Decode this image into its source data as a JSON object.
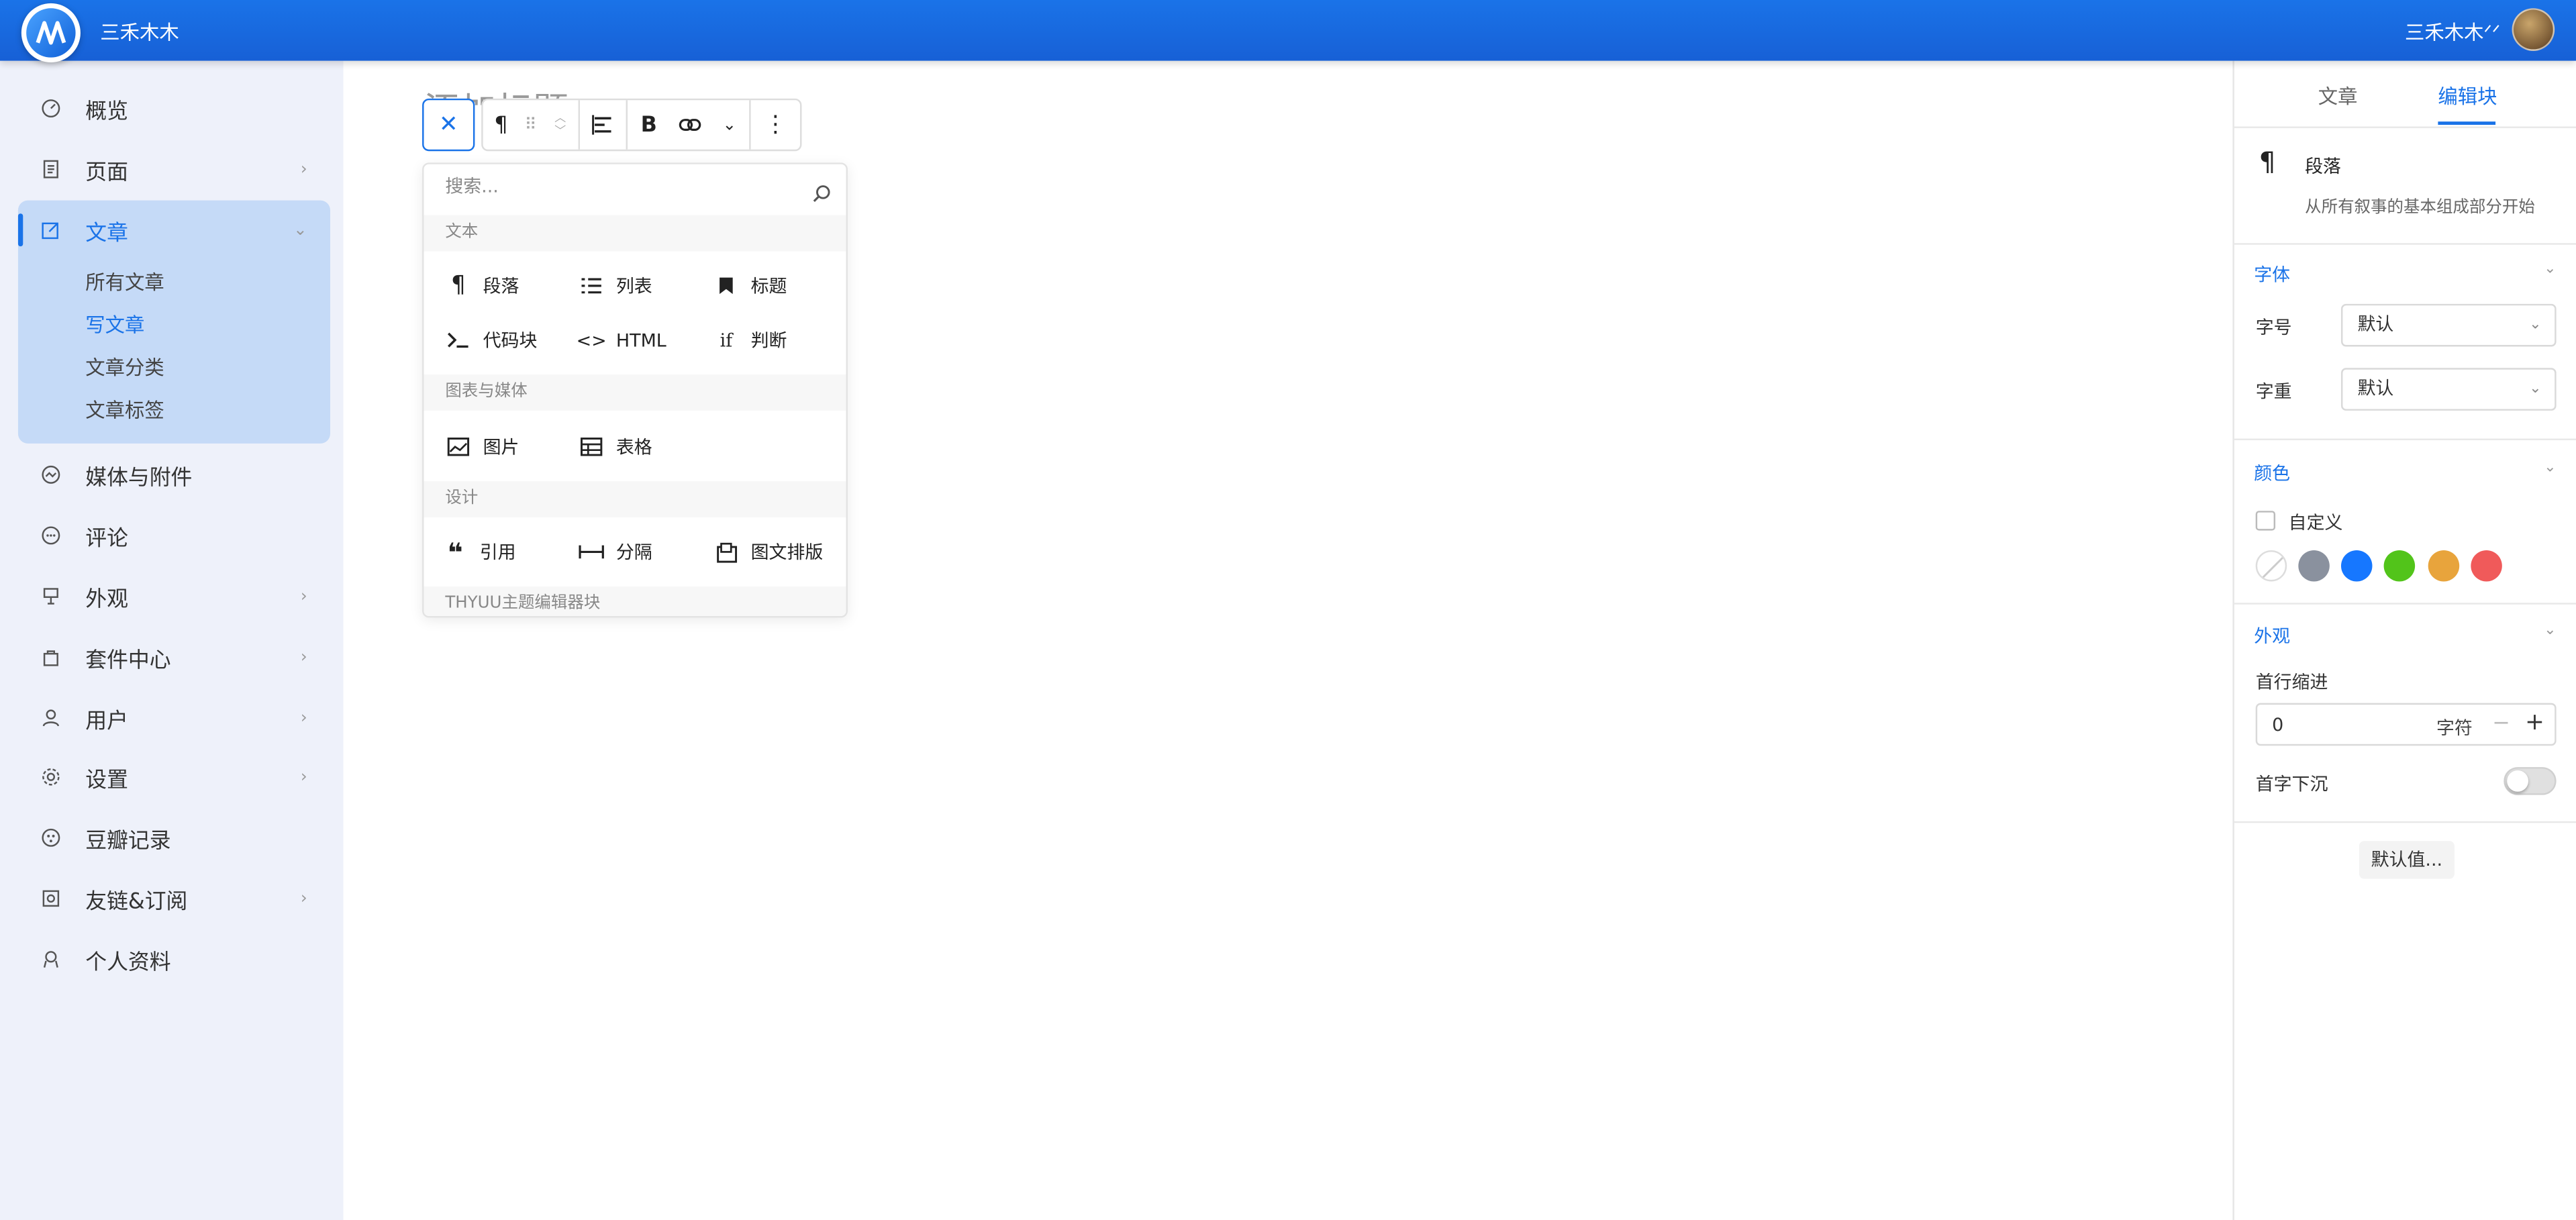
{
  "header": {
    "site_name": "三禾木木",
    "user_name": "三禾木木ᐟᐟ"
  },
  "sidebar": {
    "items": [
      {
        "label": "概览",
        "icon": "dashboard-icon"
      },
      {
        "label": "页面",
        "icon": "page-icon"
      },
      {
        "label": "文章",
        "icon": "edit-icon"
      },
      {
        "label": "媒体与附件",
        "icon": "media-icon"
      },
      {
        "label": "评论",
        "icon": "comment-icon"
      },
      {
        "label": "外观",
        "icon": "appearance-icon"
      },
      {
        "label": "套件中心",
        "icon": "bag-icon"
      },
      {
        "label": "用户",
        "icon": "user-icon"
      },
      {
        "label": "设置",
        "icon": "gear-icon"
      },
      {
        "label": "豆瓣记录",
        "icon": "douban-icon"
      },
      {
        "label": "友链&订阅",
        "icon": "link-icon"
      },
      {
        "label": "个人资料",
        "icon": "profile-icon"
      }
    ],
    "post_sub": [
      "所有文章",
      "写文章",
      "文章分类",
      "文章标签"
    ]
  },
  "editor": {
    "title_placeholder": "添加标题"
  },
  "inserter": {
    "search_placeholder": "搜索...",
    "categories": [
      "文本",
      "图表与媒体",
      "设计",
      "THYUU主题编辑器块"
    ],
    "text_blocks": [
      "段落",
      "列表",
      "标题",
      "代码块",
      "HTML",
      "判断"
    ],
    "media_blocks": [
      "图片",
      "表格"
    ],
    "design_blocks": [
      "引用",
      "分隔",
      "图文排版"
    ]
  },
  "right_panel": {
    "tabs": [
      "文章",
      "编辑块"
    ],
    "block_name": "段落",
    "block_desc": "从所有叙事的基本组成部分开始",
    "font_section": "字体",
    "font_size_label": "字号",
    "font_size_value": "默认",
    "font_weight_label": "字重",
    "font_weight_value": "默认",
    "color_section": "颜色",
    "custom_label": "自定义",
    "colors": [
      "#ffffff",
      "#8a919e",
      "#1677ff",
      "#52c41a",
      "#e8a43c",
      "#f05a5a"
    ],
    "appearance_section": "外观",
    "indent_label": "首行缩进",
    "indent_value": "0",
    "indent_unit": "字符",
    "dropcap_label": "首字下沉",
    "dropcap_on": false,
    "default_btn": "默认值..."
  }
}
